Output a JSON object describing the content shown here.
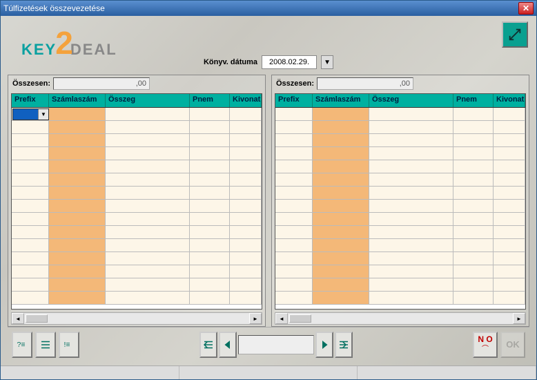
{
  "window": {
    "title": "Túlfizetések összevezetése"
  },
  "logo": {
    "part1": "KEY",
    "part2": "2",
    "part3": "DEAL"
  },
  "date": {
    "label": "Könyv. dátuma",
    "value": "2008.02.29."
  },
  "leftPanel": {
    "sumLabel": "Összesen:",
    "sumValue": ",00",
    "columns": {
      "prefix": "Prefix",
      "szam": "Számlaszám",
      "osszeg": "Összeg",
      "pnem": "Pnem",
      "kivonat": "Kivonat"
    }
  },
  "rightPanel": {
    "sumLabel": "Összesen:",
    "sumValue": ",00",
    "columns": {
      "prefix": "Prefix",
      "szam": "Számlaszám",
      "osszeg": "Összeg",
      "pnem": "Pnem",
      "kivonat": "Kivonat"
    }
  },
  "buttons": {
    "no": "N O",
    "ok": "OK"
  },
  "grid": {
    "rowCount": 15
  }
}
